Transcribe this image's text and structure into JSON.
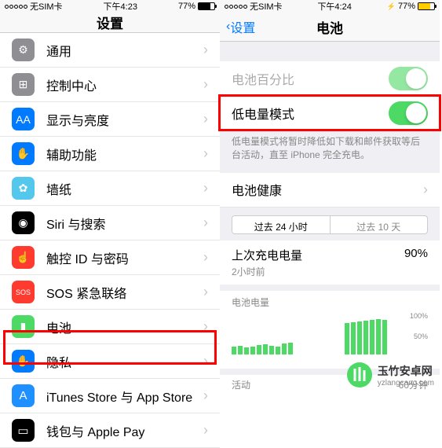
{
  "left": {
    "status": {
      "carrier": "无SIM卡",
      "time": "下午4:23",
      "battery": "77%"
    },
    "nav": {
      "title": "设置"
    },
    "items": [
      {
        "icon": "⚙",
        "color": "#8e8e93",
        "label": "通用"
      },
      {
        "icon": "⊞",
        "color": "#8e8e93",
        "label": "控制中心"
      },
      {
        "icon": "AA",
        "color": "#007aff",
        "label": "显示与亮度"
      },
      {
        "icon": "✋",
        "color": "#007aff",
        "label": "辅助功能"
      },
      {
        "icon": "✿",
        "color": "#54c7ec",
        "label": "墙纸"
      },
      {
        "icon": "◉",
        "color": "#000",
        "label": "Siri 与搜索"
      },
      {
        "icon": "☝",
        "color": "#ff3b30",
        "label": "触控 ID 与密码"
      },
      {
        "icon": "SOS",
        "color": "#ff3b30",
        "label": "SOS 紧急联络"
      },
      {
        "icon": "▮",
        "color": "#4cd964",
        "label": "电池",
        "highlighted": true
      },
      {
        "icon": "✋",
        "color": "#007aff",
        "label": "隐私"
      }
    ],
    "items2": [
      {
        "icon": "A",
        "color": "#1e90ff",
        "label": "iTunes Store 与 App Store"
      },
      {
        "icon": "▭",
        "color": "#000",
        "label": "钱包与 Apple Pay"
      }
    ]
  },
  "right": {
    "status": {
      "carrier": "无SIM卡",
      "time": "下午4:24",
      "battery": "77%"
    },
    "nav": {
      "back": "设置",
      "title": "电池"
    },
    "rows": [
      {
        "label": "电池百分比",
        "dim": true
      },
      {
        "label": "低电量模式",
        "highlighted": true
      }
    ],
    "footer": "低电量模式将暂时降低如下载和邮件获取等后台活动，直至 iPhone 完全充电。",
    "health": {
      "label": "电池健康"
    },
    "segments": [
      "过去 24 小时",
      "过去 10 天"
    ],
    "charge": {
      "title": "上次充电电量",
      "value": "90%",
      "sub": "2小时前"
    },
    "chart_label": "电池电量",
    "activity_label": "活动",
    "time_label": "60分钟"
  },
  "chart_data": {
    "type": "bar",
    "title": "电池电量",
    "ylabel": "%",
    "ylim": [
      0,
      100
    ],
    "values": [
      20,
      22,
      18,
      20,
      24,
      26,
      22,
      20,
      28,
      30,
      0,
      0,
      0,
      0,
      0,
      0,
      0,
      0,
      80,
      82,
      84,
      86,
      88,
      90,
      88
    ]
  },
  "watermark": {
    "text": "玉竹安卓网",
    "sub": "yzlangcang.com"
  }
}
